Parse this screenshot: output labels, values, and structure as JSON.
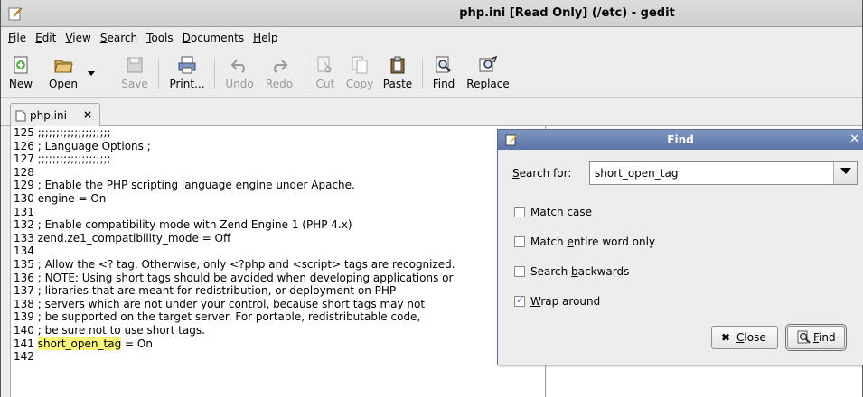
{
  "window": {
    "title": "php.ini [Read Only] (/etc) - gedit"
  },
  "menu": [
    "File",
    "Edit",
    "View",
    "Search",
    "Tools",
    "Documents",
    "Help"
  ],
  "toolbar": {
    "new": "New",
    "open": "Open",
    "save": "Save",
    "print": "Print...",
    "undo": "Undo",
    "redo": "Redo",
    "cut": "Cut",
    "copy": "Copy",
    "paste": "Paste",
    "find": "Find",
    "replace": "Replace"
  },
  "tab": {
    "label": "php.ini",
    "close": "×"
  },
  "editor": {
    "lines": [
      {
        "num": "125",
        "text": ";;;;;;;;;;;;;;;;;;;;"
      },
      {
        "num": "126",
        "text": "; Language Options ;"
      },
      {
        "num": "127",
        "text": ";;;;;;;;;;;;;;;;;;;;"
      },
      {
        "num": "128",
        "text": ""
      },
      {
        "num": "129",
        "text": "; Enable the PHP scripting language engine under Apache."
      },
      {
        "num": "130",
        "text": "engine = On"
      },
      {
        "num": "131",
        "text": ""
      },
      {
        "num": "132",
        "text": "; Enable compatibility mode with Zend Engine 1 (PHP 4.x)"
      },
      {
        "num": "133",
        "text": "zend.ze1_compatibility_mode = Off"
      },
      {
        "num": "134",
        "text": ""
      },
      {
        "num": "135",
        "text": "; Allow the <? tag.  Otherwise, only <?php and <script> tags are recognized."
      },
      {
        "num": "136",
        "text": "; NOTE: Using short tags should be avoided when developing applications or"
      },
      {
        "num": "137",
        "text": "; libraries that are meant for redistribution, or deployment on PHP"
      },
      {
        "num": "138",
        "text": "; servers which are not under your control, because short tags may not"
      },
      {
        "num": "139",
        "text": "; be supported on the target server. For portable, redistributable code,"
      },
      {
        "num": "140",
        "text": "; be sure not to use short tags."
      },
      {
        "num": "141",
        "text": "short_open_tag",
        "rest": " = On"
      },
      {
        "num": "142",
        "text": ""
      }
    ]
  },
  "find_dialog": {
    "title": "Find",
    "search_label": "Search for:",
    "search_value": "short_open_tag",
    "match_case": "Match case",
    "match_word": "Match entire word only",
    "search_backwards": "Search backwards",
    "wrap_around": "Wrap around",
    "wrap_checked": true,
    "close_button": "Close",
    "find_button": "Find"
  },
  "colors": {
    "highlight": "#fbf77a",
    "dialog_title": "#6a82b3"
  }
}
